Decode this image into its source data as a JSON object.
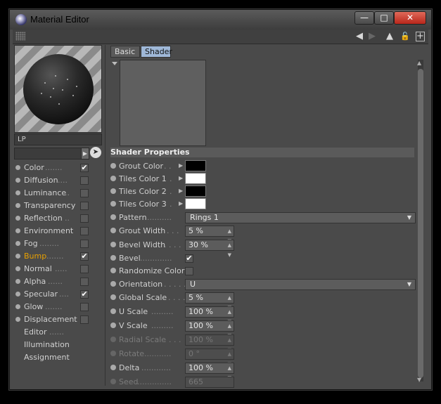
{
  "window": {
    "title": "Material Editor",
    "minimize": "—",
    "maximize": "□",
    "close": "✕"
  },
  "toolbar": {
    "back": "◀",
    "forward": "▶",
    "navigate": "▲",
    "lock": "🔓",
    "new": "+"
  },
  "material": {
    "name": "LP"
  },
  "channels": [
    {
      "label": "Color",
      "checked": "✔"
    },
    {
      "label": "Diffusion",
      "checked": ""
    },
    {
      "label": "Luminance",
      "checked": ""
    },
    {
      "label": "Transparency",
      "checked": ""
    },
    {
      "label": "Reflection",
      "checked": ""
    },
    {
      "label": "Environment",
      "checked": ""
    },
    {
      "label": "Fog",
      "checked": ""
    },
    {
      "label": "Bump",
      "checked": "✔"
    },
    {
      "label": "Normal",
      "checked": ""
    },
    {
      "label": "Alpha",
      "checked": ""
    },
    {
      "label": "Specular",
      "checked": "✔"
    },
    {
      "label": "Glow",
      "checked": ""
    },
    {
      "label": "Displacement",
      "checked": ""
    }
  ],
  "extras": [
    "Editor",
    "Illumination",
    "Assignment"
  ],
  "tabs": {
    "basic": "Basic",
    "shader": "Shader"
  },
  "section": {
    "title": "Shader Properties"
  },
  "props": {
    "grout_color": {
      "label": "Grout Color",
      "color": "#000000"
    },
    "tiles_color_1": {
      "label": "Tiles Color 1",
      "color": "#ffffff"
    },
    "tiles_color_2": {
      "label": "Tiles Color 2",
      "color": "#000000"
    },
    "tiles_color_3": {
      "label": "Tiles Color 3",
      "color": "#ffffff"
    },
    "pattern": {
      "label": "Pattern",
      "value": "Rings 1"
    },
    "grout_width": {
      "label": "Grout Width",
      "value": "5 %"
    },
    "bevel_width": {
      "label": "Bevel Width",
      "value": "30 %"
    },
    "bevel": {
      "label": "Bevel",
      "checked": "✔"
    },
    "randomize_color": {
      "label": "Randomize Color",
      "checked": ""
    },
    "orientation": {
      "label": "Orientation",
      "value": "U"
    },
    "global_scale": {
      "label": "Global Scale",
      "value": "5 %"
    },
    "u_scale": {
      "label": "U Scale",
      "value": "100 %"
    },
    "v_scale": {
      "label": "V Scale",
      "value": "100 %"
    },
    "radial_scale": {
      "label": "Radial Scale",
      "value": "100 %"
    },
    "rotate": {
      "label": "Rotate",
      "value": "0 °"
    },
    "delta": {
      "label": "Delta",
      "value": "100 %"
    },
    "seed": {
      "label": "Seed",
      "value": "665"
    }
  },
  "colors": {
    "active_channel": "#e8a000",
    "tab_selected": "#9fb8d8"
  }
}
